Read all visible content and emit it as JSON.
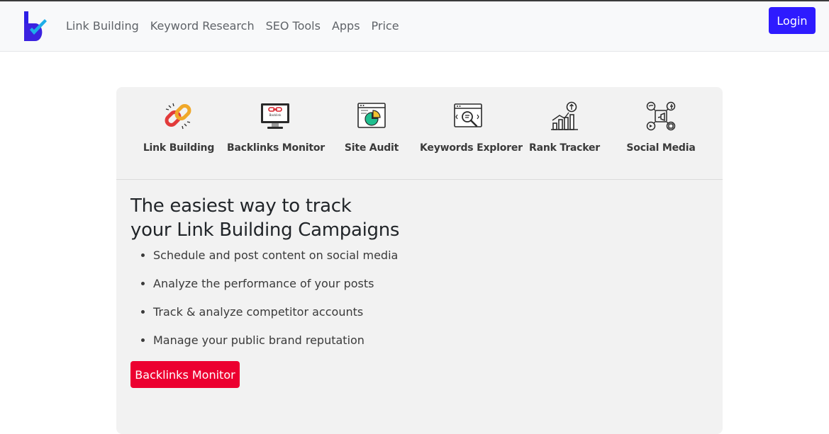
{
  "nav": {
    "brand_icon": "checkmark-logo-icon",
    "links": [
      "Link Building",
      "Keyword Research",
      "SEO Tools",
      "Apps",
      "Price"
    ],
    "login_label": "Login"
  },
  "tools": [
    {
      "label": "Link Building",
      "icon": "chain-link-icon"
    },
    {
      "label": "Backlinks Monitor",
      "icon": "monitor-icon",
      "icon_text": "Backlink"
    },
    {
      "label": "Site Audit",
      "icon": "pie-chart-browser-icon"
    },
    {
      "label": "Keywords Explorer",
      "icon": "magnifier-browser-icon"
    },
    {
      "label": "Rank Tracker",
      "icon": "bar-chart-arrow-icon"
    },
    {
      "label": "Social Media",
      "icon": "social-network-icon"
    }
  ],
  "hero": {
    "title_line1": "The easiest way to track",
    "title_line2": "your Link Building Campaigns",
    "features": [
      "Schedule and post content on social media",
      "Analyze the performance of your posts",
      "Track & analyze competitor accounts",
      "Manage your public brand reputation"
    ],
    "cta_label": "Backlinks Monitor"
  },
  "colors": {
    "primary": "#2e1bff",
    "cta": "#ec0030",
    "card_bg": "#f2f2f2",
    "navbar_bg": "#f8f9fa"
  }
}
